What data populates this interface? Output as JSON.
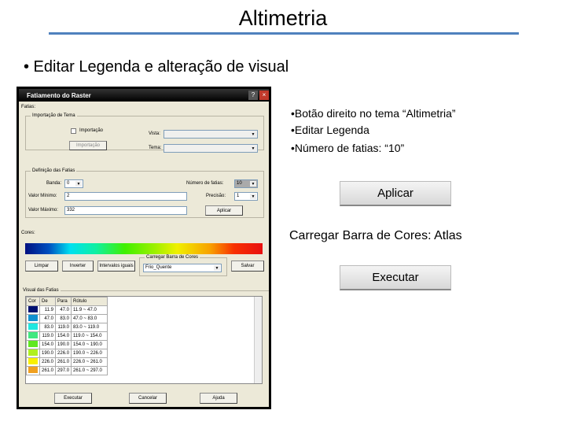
{
  "slide": {
    "title": "Altimetria",
    "bullet": "• Editar Legenda e alteração de visual",
    "notes": [
      "•Botão direito no tema “Altimetria”",
      "•Editar Legenda",
      "•Número de fatias: “10”"
    ],
    "apply_label": "Aplicar",
    "color_bar_note": "Carregar Barra de Cores: Atlas",
    "execute_label": "Executar"
  },
  "dialog": {
    "title": "Fatiamento do Raster",
    "help": "?",
    "close": "×",
    "fatias_label": "Fatias:",
    "import_group": "Importação de Tema",
    "import_check": "Importação",
    "import_button": "Importação",
    "view_label": "Vista:",
    "theme_label": "Tema:",
    "def_group": "Definição das Fatias",
    "band_label": "Banda:",
    "band_value": "0",
    "slices_label": "Número de fatias:",
    "slices_value": "10",
    "min_label": "Valor Mínimo:",
    "min_value": "2",
    "max_label": "Valor Máximo:",
    "max_value": "332",
    "precision_label": "Precisão:",
    "precision_value": "1",
    "apply": "Aplicar",
    "colors_label": "Cores:",
    "clear": "Limpar",
    "invert": "Inverter",
    "equal": "Intervalos iguais",
    "load_group": "Carregar Barra de Cores",
    "load_value": "Frio_Quente",
    "save": "Salvar",
    "visual_group": "Visual das Fatias",
    "columns": [
      "Cor",
      "De",
      "Para",
      "Rótulo"
    ],
    "rows": [
      {
        "color": "#001070",
        "de": "11.9",
        "para": "47.0",
        "label": "11.9 ~ 47.0"
      },
      {
        "color": "#1090d0",
        "de": "47.0",
        "para": "83.0",
        "label": "47.0 ~ 83.0"
      },
      {
        "color": "#20e8e0",
        "de": "83.0",
        "para": "119.0",
        "label": "83.0 ~ 119.0"
      },
      {
        "color": "#40e880",
        "de": "119.0",
        "para": "154.0",
        "label": "119.0 ~ 154.0"
      },
      {
        "color": "#60e820",
        "de": "154.0",
        "para": "190.0",
        "label": "154.0 ~ 190.0"
      },
      {
        "color": "#b0f020",
        "de": "190.0",
        "para": "226.0",
        "label": "190.0 ~ 226.0"
      },
      {
        "color": "#f8f000",
        "de": "226.0",
        "para": "261.0",
        "label": "226.0 ~ 261.0"
      },
      {
        "color": "#f0a020",
        "de": "261.0",
        "para": "297.0",
        "label": "261.0 ~ 297.0"
      }
    ],
    "execute": "Executar",
    "cancel": "Cancelar",
    "help_button": "Ajuda"
  }
}
